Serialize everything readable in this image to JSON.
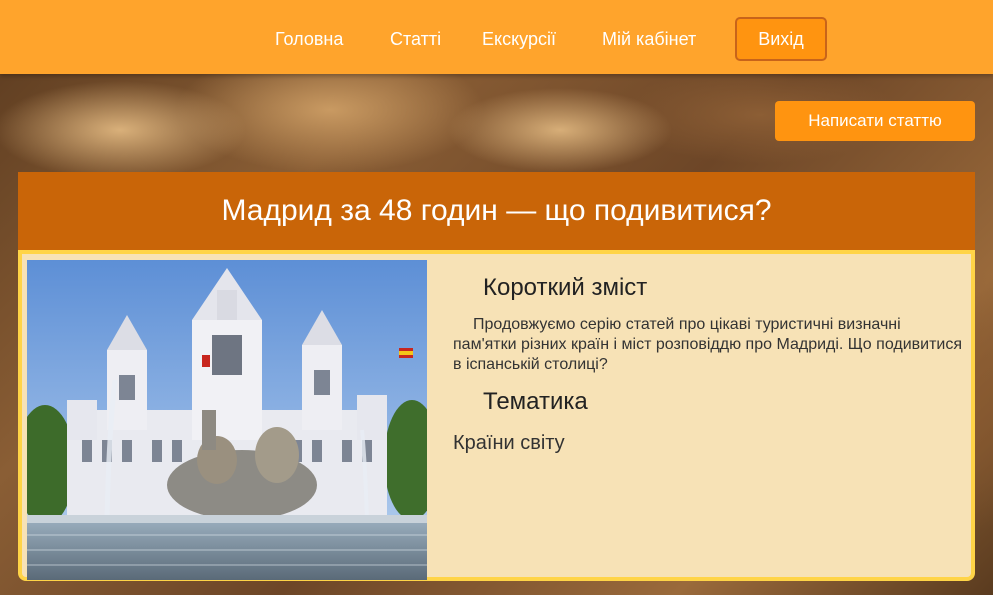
{
  "nav": {
    "items": [
      {
        "label": "Головна"
      },
      {
        "label": "Статті"
      },
      {
        "label": "Екскурсії"
      },
      {
        "label": "Мій кабінет"
      }
    ],
    "logout_label": "Вихід"
  },
  "actions": {
    "write_article_label": "Написати статтю"
  },
  "article": {
    "title": "Мадрид за 48 годин — що подивитися?",
    "summary_heading": "Короткий зміст",
    "summary_text": "Продовжуємо серію статей про цікаві туристичні визначні пам'ятки різних країн і міст розповіддю про Мадриді. Що подивитися в іспанській столиці?",
    "topic_heading": "Тематика",
    "topic_value": "Країни світу",
    "image_icon": "madrid-palace-photo"
  },
  "colors": {
    "navbar": "#ffa42c",
    "button": "#ff9410",
    "title_bar": "#c96508",
    "card_bg": "#f7e2b6",
    "card_border": "#ffd447"
  }
}
